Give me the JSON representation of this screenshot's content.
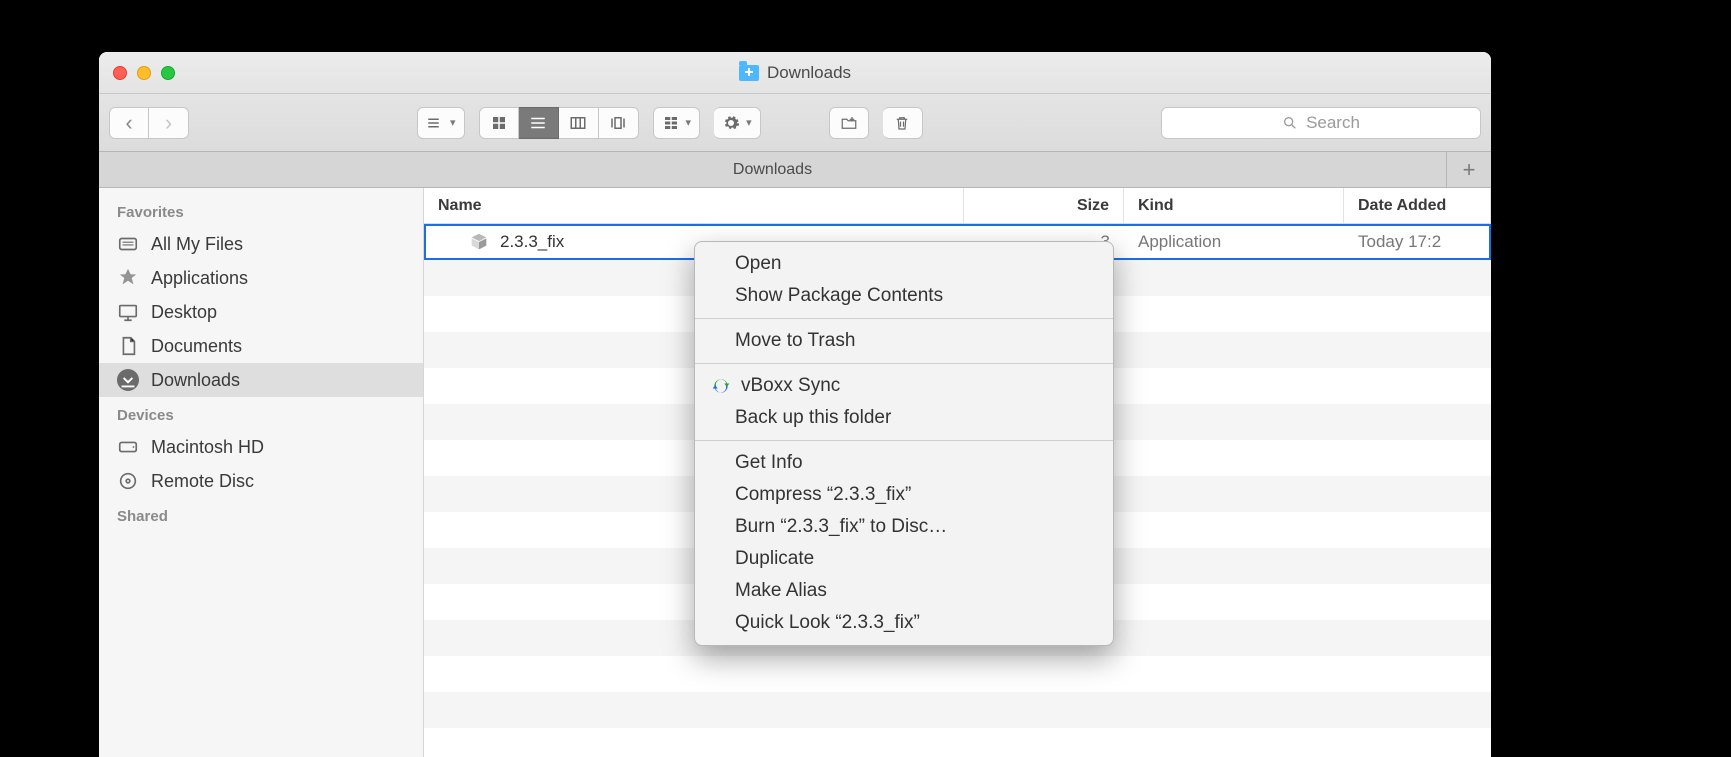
{
  "window": {
    "title": "Downloads"
  },
  "toolbar": {
    "search_placeholder": "Search"
  },
  "tabbar": {
    "tab": "Downloads"
  },
  "sidebar": {
    "sections": {
      "favorites": "Favorites",
      "devices": "Devices",
      "shared": "Shared"
    },
    "favorites": [
      {
        "label": "All My Files"
      },
      {
        "label": "Applications"
      },
      {
        "label": "Desktop"
      },
      {
        "label": "Documents"
      },
      {
        "label": "Downloads"
      }
    ],
    "devices": [
      {
        "label": "Macintosh HD"
      },
      {
        "label": "Remote Disc"
      }
    ]
  },
  "columns": {
    "name": "Name",
    "size": "Size",
    "kind": "Kind",
    "date": "Date Added"
  },
  "files": [
    {
      "name": "2.3.3_fix",
      "size_suffix": "3",
      "kind": "Application",
      "date": "Today 17:2"
    }
  ],
  "context_menu": {
    "open": "Open",
    "show_pkg": "Show Package Contents",
    "trash": "Move to Trash",
    "vboxx": "vBoxx Sync",
    "backup": "Back up this folder",
    "getinfo": "Get Info",
    "compress": "Compress “2.3.3_fix”",
    "burn": "Burn “2.3.3_fix” to Disc…",
    "duplicate": "Duplicate",
    "alias": "Make Alias",
    "quicklook": "Quick Look “2.3.3_fix”"
  }
}
